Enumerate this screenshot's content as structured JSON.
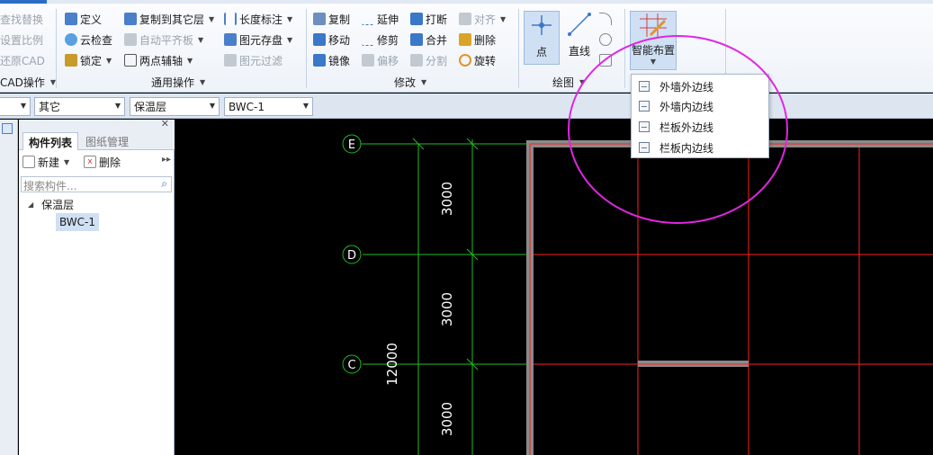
{
  "ribbon": {
    "col0": [
      "查找替换",
      "设置比例",
      "还原CAD",
      "CAD操作"
    ],
    "define": "定义",
    "cloud_check": "云检查",
    "lock": "锁定",
    "copy_to_layer": "复制到其它层",
    "auto_flat": "自动平齐板",
    "two_point_axis": "两点辅轴",
    "length_dim": "长度标注",
    "save_elem": "图元存盘",
    "elem_filter": "图元过滤",
    "group_common": "通用操作",
    "copy": "复制",
    "move": "移动",
    "mirror": "镜像",
    "extend": "延伸",
    "trim": "修剪",
    "offset": "偏移",
    "break": "打断",
    "merge": "合并",
    "split": "分割",
    "align": "对齐",
    "delete": "删除",
    "rotate": "旋转",
    "group_modify": "修改",
    "point": "点",
    "line": "直线",
    "group_draw": "绘图",
    "smart_layout": "智能布置"
  },
  "combos": {
    "c1": "其它",
    "c2": "保温层",
    "c3": "BWC-1"
  },
  "panel": {
    "tab_components": "构件列表",
    "tab_drawings": "图纸管理",
    "new": "新建",
    "delete": "删除",
    "search_placeholder": "搜索构件...",
    "tree_parent": "保温层",
    "tree_child": "BWC-1"
  },
  "canvas": {
    "axis_labels": [
      "E",
      "D",
      "C"
    ],
    "dims": [
      "3000",
      "3000",
      "3000"
    ],
    "total_dim": "12000"
  },
  "menu": {
    "items": [
      "外墙外边线",
      "外墙内边线",
      "栏板外边线",
      "栏板内边线"
    ]
  },
  "colors": {
    "grid": "#ff2020",
    "axis": "#1fbf1f",
    "wall": "#8a8a8a",
    "highlight": "#e026e0"
  }
}
